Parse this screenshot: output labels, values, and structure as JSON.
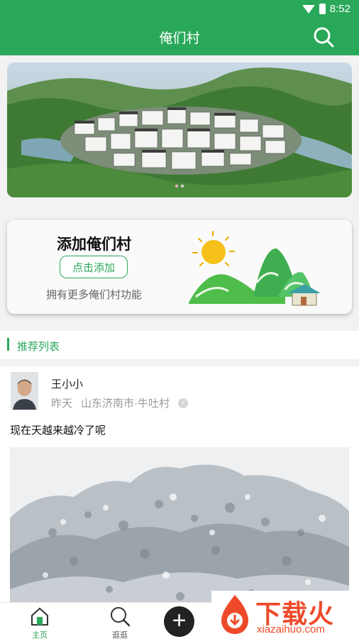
{
  "status_bar": {
    "time": "8:52"
  },
  "app_bar": {
    "title": "俺们村"
  },
  "banner": {
    "active_slide_index": 1,
    "slide_count": 2
  },
  "add_card": {
    "title": "添加俺们村",
    "button_label": "点击添加",
    "description": "拥有更多俺们村功能"
  },
  "section": {
    "title": "推荐列表"
  },
  "post": {
    "username": "王小小",
    "time": "昨天",
    "location": "山东济南市·牛吐村",
    "content": "现在天越来越冷了呢"
  },
  "bottom_nav": {
    "home_label": "主页",
    "stroll_label": "逛逛"
  },
  "watermark": {
    "brand": "下载火",
    "domain": "xiazaihuo.com"
  },
  "colors": {
    "primary": "#2aa85a",
    "watermark": "#ee4a2a"
  }
}
